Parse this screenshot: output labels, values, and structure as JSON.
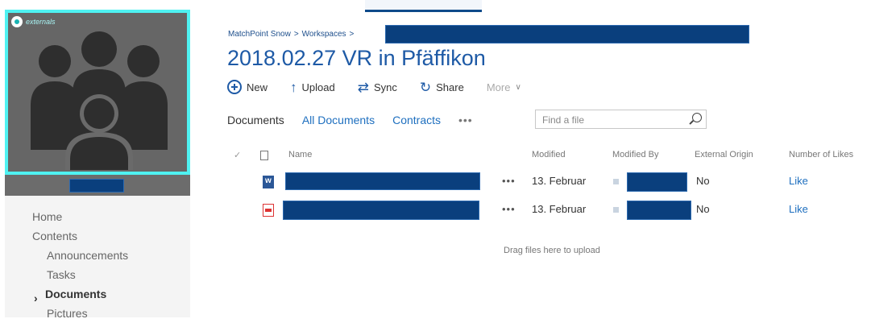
{
  "sidebar": {
    "tile_badge_label": "externals",
    "nav": [
      {
        "label": "Home",
        "level": 0,
        "active": false
      },
      {
        "label": "Contents",
        "level": 0,
        "active": false
      },
      {
        "label": "Announcements",
        "level": 1,
        "active": false
      },
      {
        "label": "Tasks",
        "level": 1,
        "active": false
      },
      {
        "label": "Documents",
        "level": 0,
        "active": true
      },
      {
        "label": "Pictures",
        "level": 1,
        "active": false
      }
    ]
  },
  "breadcrumb": {
    "items": [
      "MatchPoint Snow",
      "Workspaces"
    ],
    "separator": ">"
  },
  "page_title": "2018.02.27 VR in Pfäffikon",
  "commands": {
    "new": "New",
    "upload": "Upload",
    "sync": "Sync",
    "share": "Share",
    "more": "More"
  },
  "views": {
    "current": "Documents",
    "all": "All Documents",
    "contracts": "Contracts",
    "ellipsis": "•••"
  },
  "search": {
    "placeholder": "Find a file"
  },
  "columns": {
    "name": "Name",
    "modified": "Modified",
    "modified_by": "Modified By",
    "external_origin": "External Origin",
    "likes": "Number of Likes"
  },
  "rows": [
    {
      "type": "word",
      "menu": "•••",
      "modified": "13. Februar",
      "external_origin": "No",
      "like": "Like"
    },
    {
      "type": "pdf",
      "menu": "•••",
      "modified": "13. Februar",
      "external_origin": "No",
      "like": "Like"
    }
  ],
  "drop_hint": "Drag files here to upload",
  "colors": {
    "accent": "#1e5aa6",
    "tile_border": "#4ff2f2",
    "redaction": "#0a3f7d"
  }
}
